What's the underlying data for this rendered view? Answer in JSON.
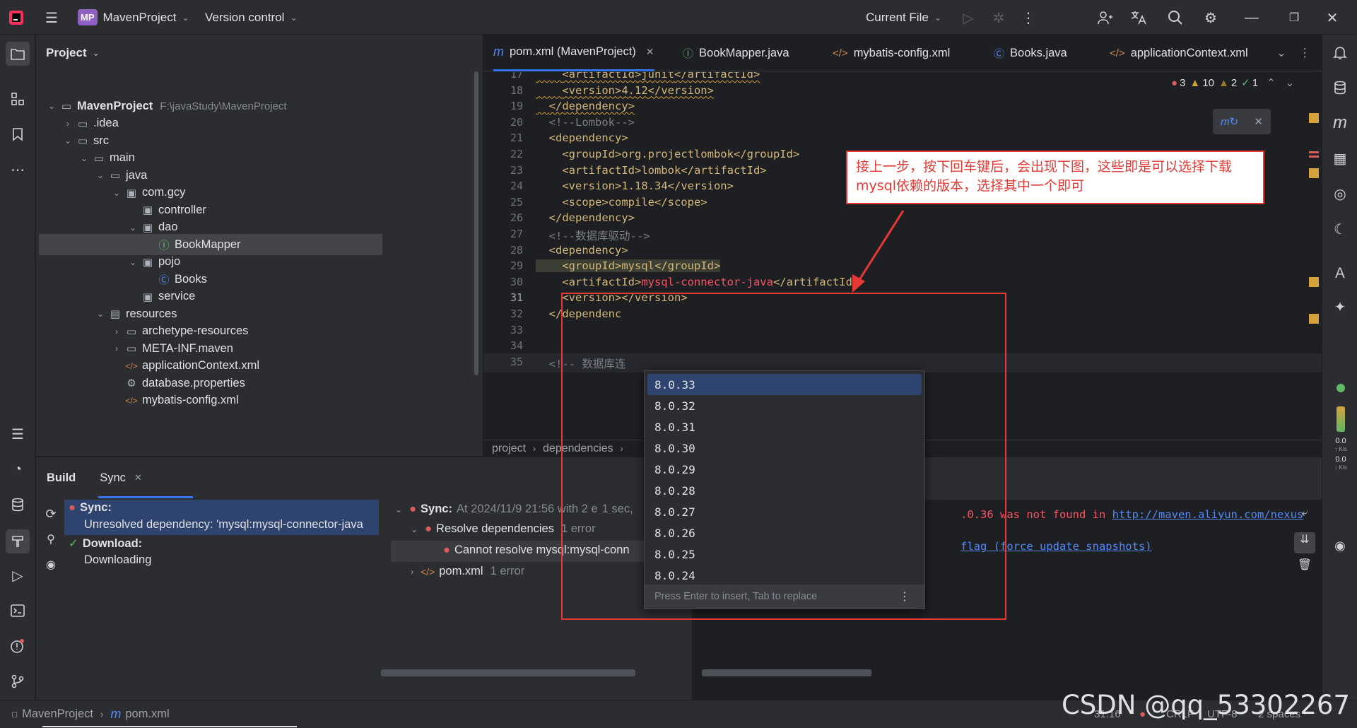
{
  "titlebar": {
    "project_badge": "MP",
    "project_name": "MavenProject",
    "vcs": "Version control",
    "run_config": "Current File"
  },
  "project_panel": {
    "header": "Project",
    "tree": [
      {
        "label": "MavenProject",
        "hint": "F:\\javaStudy\\MavenProject",
        "icon": "folder-icon",
        "arrow": "⌄"
      },
      {
        "label": ".idea",
        "icon": "folder-icon",
        "arrow": "›"
      },
      {
        "label": "src",
        "icon": "folder-icon",
        "arrow": "⌄"
      },
      {
        "label": "main",
        "icon": "folder-icon",
        "arrow": "⌄"
      },
      {
        "label": "java",
        "icon": "folder-icon",
        "arrow": "⌄"
      },
      {
        "label": "com.gcy",
        "icon": "package-icon",
        "arrow": "⌄"
      },
      {
        "label": "controller",
        "icon": "package-icon",
        "arrow": ""
      },
      {
        "label": "dao",
        "icon": "package-icon",
        "arrow": "⌄"
      },
      {
        "label": "BookMapper",
        "icon": "interface-icon",
        "arrow": ""
      },
      {
        "label": "pojo",
        "icon": "package-icon",
        "arrow": "⌄"
      },
      {
        "label": "Books",
        "icon": "class-icon",
        "arrow": ""
      },
      {
        "label": "service",
        "icon": "package-icon",
        "arrow": ""
      },
      {
        "label": "resources",
        "icon": "resources-folder-icon",
        "arrow": "⌄"
      },
      {
        "label": "archetype-resources",
        "icon": "folder-icon",
        "arrow": "›"
      },
      {
        "label": "META-INF.maven",
        "icon": "folder-icon",
        "arrow": "›"
      },
      {
        "label": "applicationContext.xml",
        "icon": "xml-icon",
        "arrow": ""
      },
      {
        "label": "database.properties",
        "icon": "settings-file-icon",
        "arrow": ""
      },
      {
        "label": "mybatis-config.xml",
        "icon": "xml-icon",
        "arrow": ""
      }
    ]
  },
  "tabs": [
    {
      "label": "pom.xml (MavenProject)",
      "icon": "m",
      "active": true
    },
    {
      "label": "BookMapper.java",
      "icon": "I"
    },
    {
      "label": "mybatis-config.xml",
      "icon": "</>"
    },
    {
      "label": "Books.java",
      "icon": "C"
    },
    {
      "label": "applicationContext.xml",
      "icon": "</>"
    }
  ],
  "inspections": {
    "errors": "3",
    "warnings": "10",
    "weak": "2",
    "ok": "1"
  },
  "editor_lines": [
    {
      "n": "17",
      "html": "    <artifactId>junit</artifactId>"
    },
    {
      "n": "18",
      "html": "    <version>4.12</version>"
    },
    {
      "n": "19",
      "html": "  </dependency>"
    },
    {
      "n": "20",
      "html": "  <!--Lombok-->"
    },
    {
      "n": "21",
      "html": "  <dependency>"
    },
    {
      "n": "22",
      "html": "    <groupId>org.projectlombok</groupId>"
    },
    {
      "n": "23",
      "html": "    <artifactId>lombok</artifactId>"
    },
    {
      "n": "24",
      "html": "    <version>1.18.34</version>"
    },
    {
      "n": "25",
      "html": "    <scope>compile</scope>"
    },
    {
      "n": "26",
      "html": "  </dependency>"
    },
    {
      "n": "27",
      "html": "  <!--数据库驱动-->"
    },
    {
      "n": "28",
      "html": "  <dependency>"
    },
    {
      "n": "29",
      "html": "    <groupId>mysql</groupId>"
    },
    {
      "n": "30",
      "html": "    <artifactId>mysql-connector-java</artifactId>"
    },
    {
      "n": "31",
      "html": "    <version></version>"
    },
    {
      "n": "32",
      "html": "  </dependenc"
    },
    {
      "n": "33",
      "html": ""
    },
    {
      "n": "34",
      "html": ""
    },
    {
      "n": "35",
      "html": "  <!-- 数据库连"
    }
  ],
  "annotation": "接上一步，按下回车键后，会出现下图，这些即是可以选择下载mysql依赖的版本，选择其中一个即可",
  "breadcrumb": [
    "project",
    "dependencies"
  ],
  "completion": {
    "items": [
      "8.0.33",
      "8.0.32",
      "8.0.31",
      "8.0.30",
      "8.0.29",
      "8.0.28",
      "8.0.27",
      "8.0.26",
      "8.0.25",
      "8.0.24"
    ],
    "footer": "Press Enter to insert, Tab to replace"
  },
  "build": {
    "tabs": [
      "Build",
      "Sync"
    ],
    "left": {
      "sync_title": "Sync:",
      "sync_msg": "Unresolved dependency: 'mysql:mysql-connector-java",
      "download_title": "Download:",
      "download_msg": "Downloading"
    },
    "right": {
      "sync": "Sync:",
      "sync_info": "At 2024/11/9 21:56 with 2 e",
      "sync_time": "1 sec,",
      "resolve": "Resolve dependencies",
      "resolve_count": "1 error",
      "cannot": "Cannot resolve mysql:mysql-conn",
      "pom": "pom.xml",
      "pom_count": "1 error",
      "console1_pre": ".0.36 was not found in ",
      "console1_link": "http://maven.aliyun.com/nexus",
      "console2_link": "flag (force update snapshots)"
    }
  },
  "network": {
    "up": "0.0",
    "up_unit": "K/s",
    "down": "0.0",
    "down_unit": "K/s"
  },
  "statusbar": {
    "project": "MavenProject",
    "file": "pom.xml",
    "position": "31:16",
    "line_sep": "CRLF",
    "encoding": "UTF-8",
    "indent": "2 spaces"
  },
  "watermark": "CSDN @qq_53302267",
  "colors": {
    "accent": "#3574f0",
    "annotation": "#e53935",
    "error": "#db5c5c",
    "ok": "#5fb865"
  }
}
